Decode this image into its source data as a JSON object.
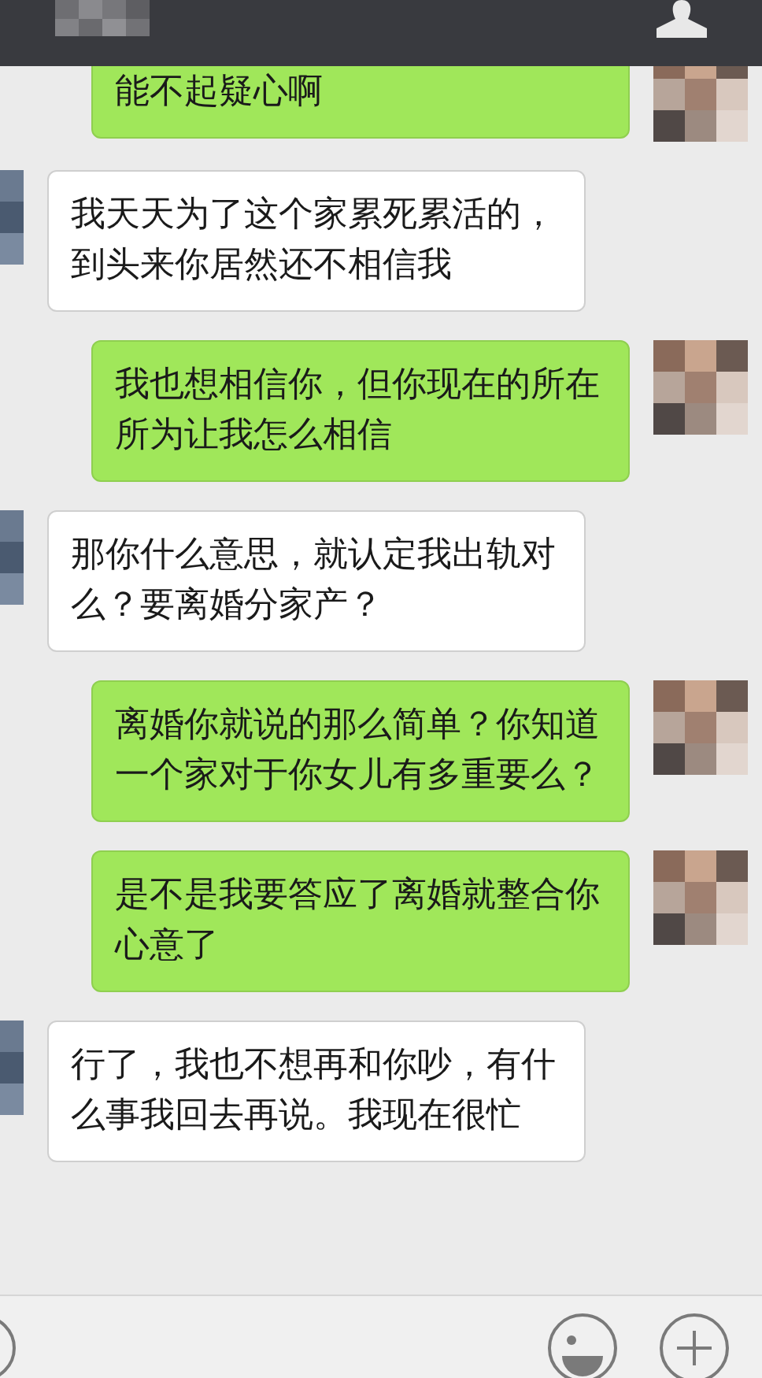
{
  "messages": [
    {
      "kind": "sent",
      "text": "能不起疑心啊"
    },
    {
      "kind": "received",
      "text": "我天天为了这个家累死累活的，到头来你居然还不相信我"
    },
    {
      "kind": "sent",
      "text": "我也想相信你，但你现在的所在所为让我怎么相信"
    },
    {
      "kind": "received",
      "text": "那你什么意思，就认定我出轨对么？要离婚分家产？"
    },
    {
      "kind": "sent",
      "text": "离婚你就说的那么简单？你知道一个家对于你女儿有多重要么？"
    },
    {
      "kind": "sent",
      "text": "是不是我要答应了离婚就整合你心意了"
    },
    {
      "kind": "received",
      "text": "行了，我也不想再和你吵，有什么事我回去再说。我现在很忙"
    }
  ]
}
